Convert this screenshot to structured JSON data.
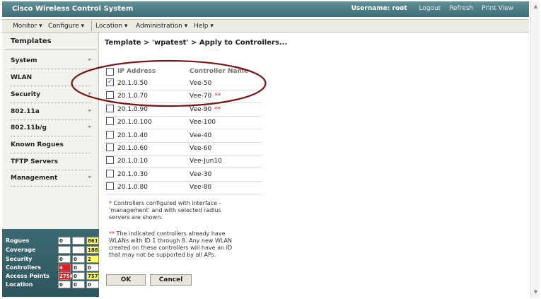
{
  "header": {
    "app_title": "Cisco Wireless Control System",
    "username_label": "Username: root",
    "logout": "Logout",
    "refresh": "Refresh",
    "print_view": "Print View"
  },
  "menu": [
    {
      "label": "Monitor ▾"
    },
    {
      "label": "Configure ▾"
    },
    {
      "label": "Location ▾"
    },
    {
      "label": "Administration ▾"
    },
    {
      "label": "Help ▾"
    }
  ],
  "sidebar": {
    "title": "Templates",
    "items": [
      {
        "label": "System",
        "has_arrow": true
      },
      {
        "label": "WLAN",
        "has_arrow": false
      },
      {
        "label": "Security",
        "has_arrow": true
      },
      {
        "label": "802.11a",
        "has_arrow": true
      },
      {
        "label": "802.11b/g",
        "has_arrow": true
      },
      {
        "label": "Known Rogues",
        "has_arrow": false
      },
      {
        "label": "TFTP Servers",
        "has_arrow": false
      },
      {
        "label": "Management",
        "has_arrow": true
      }
    ],
    "arrow_glyph": "▸"
  },
  "alarm_summary": [
    {
      "label": "Rogues",
      "c1": "0",
      "c2": "",
      "c3": "861"
    },
    {
      "label": "Coverage",
      "c1": "",
      "c2": "",
      "c3": "188"
    },
    {
      "label": "Security",
      "c1": "0",
      "c2": "0",
      "c3": "2"
    },
    {
      "label": "Controllers",
      "c1": "4",
      "c2": "0",
      "c3": "0"
    },
    {
      "label": "Access Points",
      "c1": "2754",
      "c2": "0",
      "c3": "757"
    },
    {
      "label": "Location",
      "c1": "0",
      "c2": "0",
      "c3": "0"
    }
  ],
  "alarm_colors": {
    "critical": "#e02020",
    "minor": "#ffff66",
    "normal": "#ffffff"
  },
  "page": {
    "title": "Template > 'wpatest' > Apply to Controllers..."
  },
  "table": {
    "headers": {
      "ip": "IP Address",
      "name": "Controller Name"
    },
    "rows": [
      {
        "ip": "20.1.0.50",
        "name": "Vee-50",
        "checked": true,
        "flag": ""
      },
      {
        "ip": "20.1.0.70",
        "name": "Vee-70",
        "checked": false,
        "flag": "**"
      },
      {
        "ip": "20.1.0.90",
        "name": "Vee-90",
        "checked": false,
        "flag": "**"
      },
      {
        "ip": "20.1.0.100",
        "name": "Vee-100",
        "checked": false,
        "flag": ""
      },
      {
        "ip": "20.1.0.40",
        "name": "Vee-40",
        "checked": false,
        "flag": ""
      },
      {
        "ip": "20.1.0.60",
        "name": "Vee-60",
        "checked": false,
        "flag": ""
      },
      {
        "ip": "20.1.0.10",
        "name": "Vee-Jun10",
        "checked": false,
        "flag": ""
      },
      {
        "ip": "20.1.0.30",
        "name": "Vee-30",
        "checked": false,
        "flag": ""
      },
      {
        "ip": "20.1.0.80",
        "name": "Vee-80",
        "checked": false,
        "flag": ""
      }
    ]
  },
  "notes": {
    "note1_mark": "*",
    "note1_text": " Controllers configured with interface - 'management' and with selected radius servers are shown.",
    "note2_mark": "**",
    "note2_text": " The indicated controllers already have WLANs with ID 1 through 8. Any new WLAN created on these controllers will have an ID that may not be supported by all APs."
  },
  "buttons": {
    "ok": "OK",
    "cancel": "Cancel"
  },
  "colors": {
    "header_bg": "#4a7b83",
    "highlight_ellipse": "#7a1515"
  }
}
